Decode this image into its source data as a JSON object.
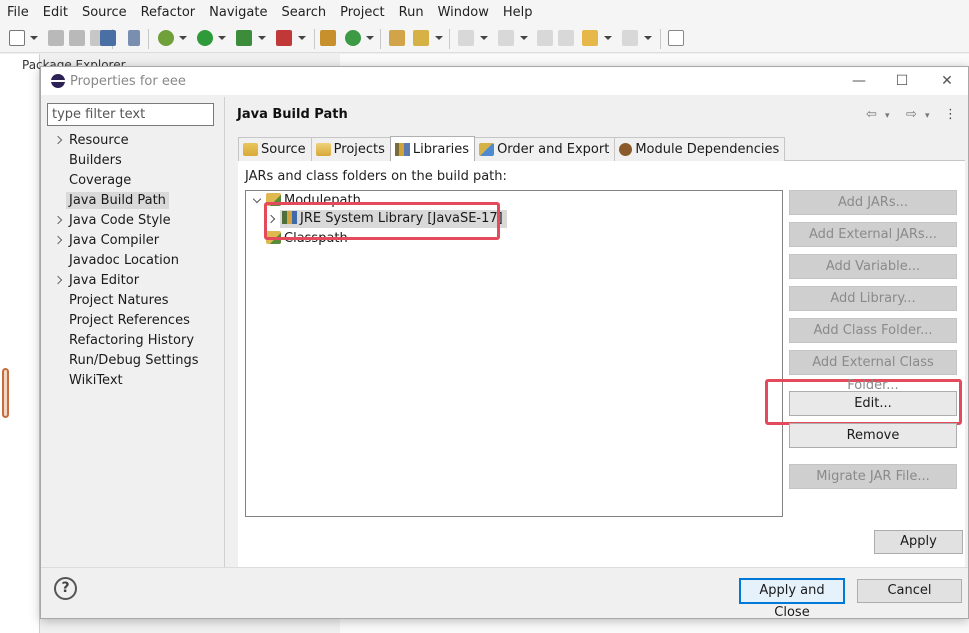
{
  "menu": [
    "File",
    "Edit",
    "Source",
    "Refactor",
    "Navigate",
    "Search",
    "Project",
    "Run",
    "Window",
    "Help"
  ],
  "background": {
    "package_explorer_title": "Package Explorer"
  },
  "dialog": {
    "title": "Properties for eee",
    "minimize": "—",
    "maximize": "☐",
    "close": "✕"
  },
  "filter": {
    "placeholder": "type filter text"
  },
  "nav": [
    {
      "label": "Resource",
      "expandable": true
    },
    {
      "label": "Builders",
      "expandable": false
    },
    {
      "label": "Coverage",
      "expandable": false
    },
    {
      "label": "Java Build Path",
      "expandable": false,
      "selected": true
    },
    {
      "label": "Java Code Style",
      "expandable": true
    },
    {
      "label": "Java Compiler",
      "expandable": true
    },
    {
      "label": "Javadoc Location",
      "expandable": false
    },
    {
      "label": "Java Editor",
      "expandable": true
    },
    {
      "label": "Project Natures",
      "expandable": false
    },
    {
      "label": "Project References",
      "expandable": false
    },
    {
      "label": "Refactoring History",
      "expandable": false
    },
    {
      "label": "Run/Debug Settings",
      "expandable": false
    },
    {
      "label": "WikiText",
      "expandable": false
    }
  ],
  "page": {
    "title": "Java Build Path",
    "tabs": [
      "Source",
      "Projects",
      "Libraries",
      "Order and Export",
      "Module Dependencies"
    ],
    "active_tab": "Libraries",
    "build_label": "JARs and class folders on the build path:",
    "tree": {
      "modulepath": "Modulepath",
      "jre": "JRE System Library [JavaSE-17]",
      "classpath": "Classpath"
    },
    "buttons": {
      "add_jars": "Add JARs...",
      "add_external_jars": "Add External JARs...",
      "add_variable": "Add Variable...",
      "add_library": "Add Library...",
      "add_class_folder": "Add Class Folder...",
      "add_external_class_folder": "Add External Class Folder...",
      "edit": "Edit...",
      "remove": "Remove",
      "migrate_jar": "Migrate JAR File..."
    },
    "apply": "Apply"
  },
  "footer": {
    "help": "?",
    "apply_and_close": "Apply and Close",
    "cancel": "Cancel"
  },
  "colors": {
    "highlight": "#e34b5c",
    "focus": "#0078d7"
  }
}
